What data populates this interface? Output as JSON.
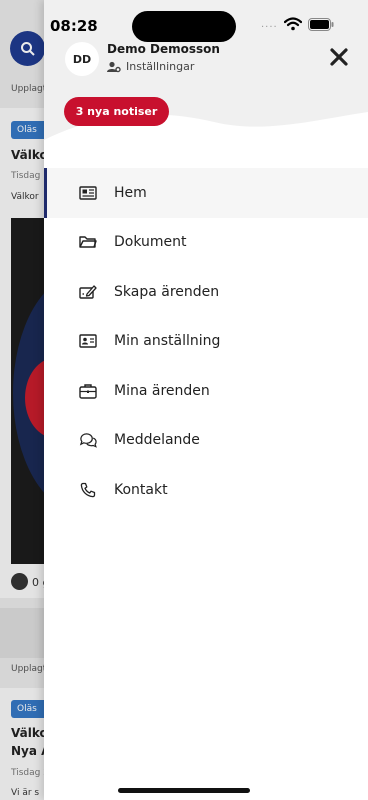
{
  "status_bar": {
    "time": "08:28",
    "signal_dots": "····"
  },
  "background": {
    "strip_top": "Upplagt",
    "card1": {
      "badge": "Oläs",
      "title": "Välko",
      "date": "Tisdag",
      "body": "Välkor"
    },
    "like_count": "0 g",
    "strip_bottom": "Upplagt",
    "card2": {
      "badge": "Oläs",
      "title_line1": "Välko",
      "title_line2": "Nya A",
      "date": "Tisdag 2",
      "body": "Vi är s"
    }
  },
  "drawer": {
    "avatar_initials": "DD",
    "user_name": "Demo Demosson",
    "settings_label": "Inställningar",
    "notice_label": "3 nya notiser",
    "menu": [
      {
        "label": "Hem",
        "icon": "newspaper-icon"
      },
      {
        "label": "Dokument",
        "icon": "folder-icon"
      },
      {
        "label": "Skapa ärenden",
        "icon": "edit-form-icon"
      },
      {
        "label": "Min anställning",
        "icon": "id-card-icon"
      },
      {
        "label": "Mina ärenden",
        "icon": "briefcase-icon"
      },
      {
        "label": "Meddelande",
        "icon": "chat-icon"
      },
      {
        "label": "Kontakt",
        "icon": "phone-icon"
      }
    ]
  },
  "colors": {
    "accent_red": "#c8102e",
    "navy": "#1f2a6b",
    "blue": "#1f3a8f"
  }
}
